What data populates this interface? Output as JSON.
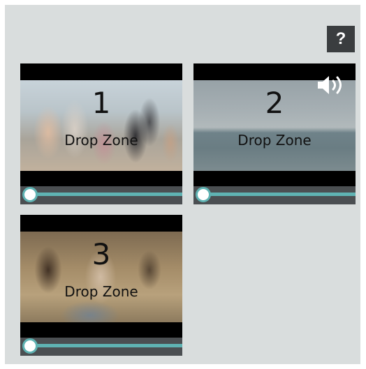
{
  "help_button": {
    "label": "?"
  },
  "zones": [
    {
      "number": "1",
      "label": "Drop Zone"
    },
    {
      "number": "2",
      "label": "Drop Zone"
    },
    {
      "number": "3",
      "label": "Drop Zone"
    }
  ],
  "scrubbers": [
    {
      "progress": 0
    },
    {
      "progress": 0
    },
    {
      "progress": 0
    }
  ],
  "icons": {
    "help": "question-mark-icon",
    "audio": "speaker-volume-icon"
  },
  "colors": {
    "panel_background": "#d9dddd",
    "track_accent": "#5fb3b3",
    "help_button_background": "#3a3d3f"
  }
}
